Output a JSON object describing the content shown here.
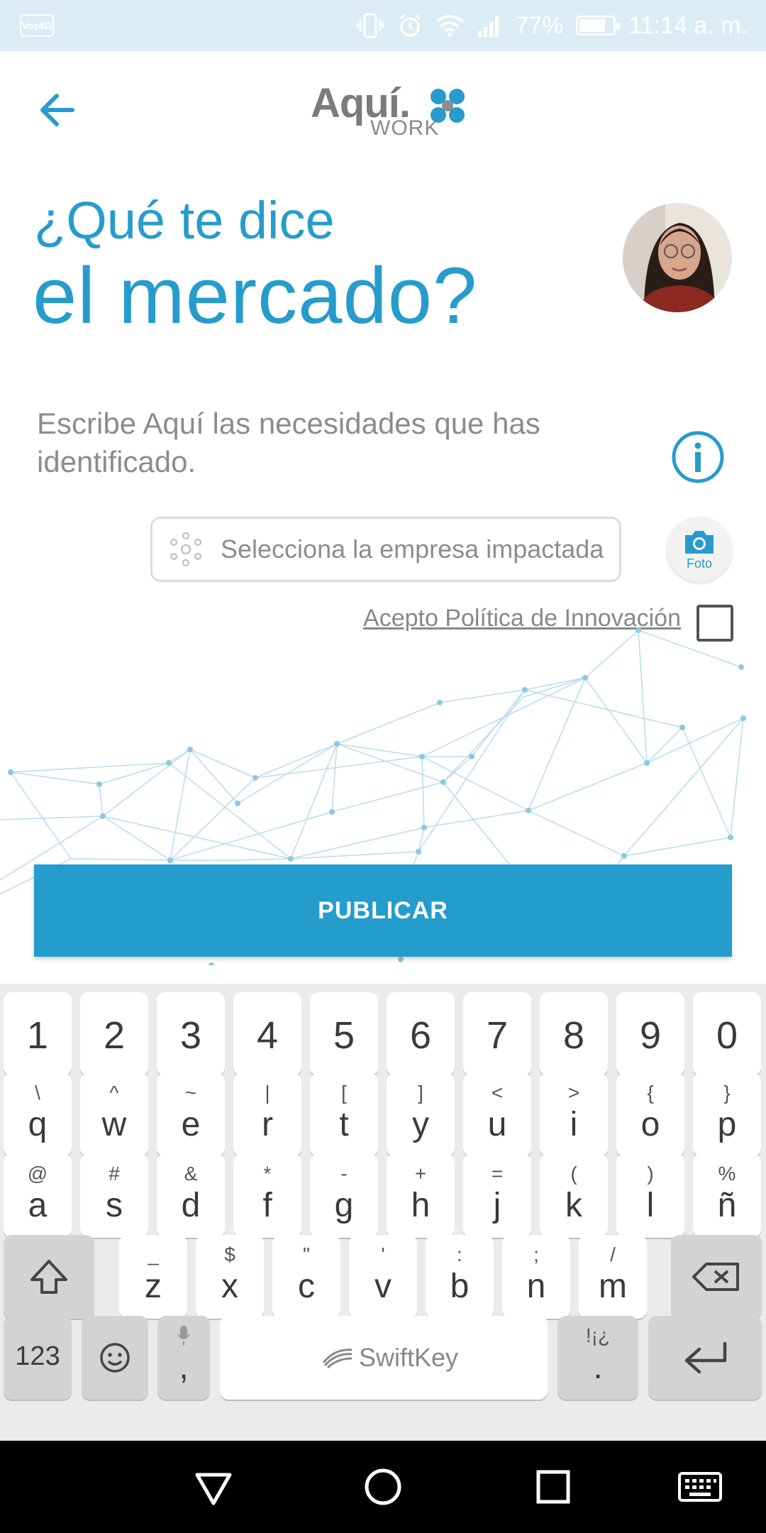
{
  "status_bar": {
    "carrier_badge": "Voz4G",
    "battery": "77%",
    "battery_level": 0.77,
    "time": "11:14 a. m."
  },
  "header": {
    "logo_word": "Aquí.",
    "logo_sub": "WORK"
  },
  "title": {
    "line1": "¿Qué te dice",
    "line2": "el mercado?"
  },
  "prompt": {
    "placeholder": "Escribe Aquí las necesidades que has identificado."
  },
  "company_select": {
    "placeholder": "Selecciona la empresa impactada"
  },
  "photo_button": {
    "label": "Foto"
  },
  "policy": {
    "label": "Acepto Política de Innovación",
    "checked": false
  },
  "publish_button": {
    "label": "PUBLICAR"
  },
  "keyboard": {
    "number_row": [
      "1",
      "2",
      "3",
      "4",
      "5",
      "6",
      "7",
      "8",
      "9",
      "0"
    ],
    "row1": [
      {
        "main": "q",
        "alt": "\\"
      },
      {
        "main": "w",
        "alt": "^"
      },
      {
        "main": "e",
        "alt": "~"
      },
      {
        "main": "r",
        "alt": "|"
      },
      {
        "main": "t",
        "alt": "["
      },
      {
        "main": "y",
        "alt": "]"
      },
      {
        "main": "u",
        "alt": "<"
      },
      {
        "main": "i",
        "alt": ">"
      },
      {
        "main": "o",
        "alt": "{"
      },
      {
        "main": "p",
        "alt": "}"
      }
    ],
    "row2": [
      {
        "main": "a",
        "alt": "@"
      },
      {
        "main": "s",
        "alt": "#"
      },
      {
        "main": "d",
        "alt": "&"
      },
      {
        "main": "f",
        "alt": "*"
      },
      {
        "main": "g",
        "alt": "-"
      },
      {
        "main": "h",
        "alt": "+"
      },
      {
        "main": "j",
        "alt": "="
      },
      {
        "main": "k",
        "alt": "("
      },
      {
        "main": "l",
        "alt": ")"
      },
      {
        "main": "ñ",
        "alt": "%"
      }
    ],
    "row3": [
      {
        "main": "z",
        "alt": "_"
      },
      {
        "main": "x",
        "alt": "$"
      },
      {
        "main": "c",
        "alt": "\""
      },
      {
        "main": "v",
        "alt": "'"
      },
      {
        "main": "b",
        "alt": ":"
      },
      {
        "main": "n",
        "alt": ";"
      },
      {
        "main": "m",
        "alt": "/"
      }
    ],
    "symbols_key": "123",
    "comma_key": ",",
    "space_label": "SwiftKey",
    "period_key": ".",
    "period_alt": "!¡¿"
  },
  "colors": {
    "accent": "#249ccc",
    "status_bar": "#dbecf5",
    "keyboard_bg": "#ebebeb"
  }
}
